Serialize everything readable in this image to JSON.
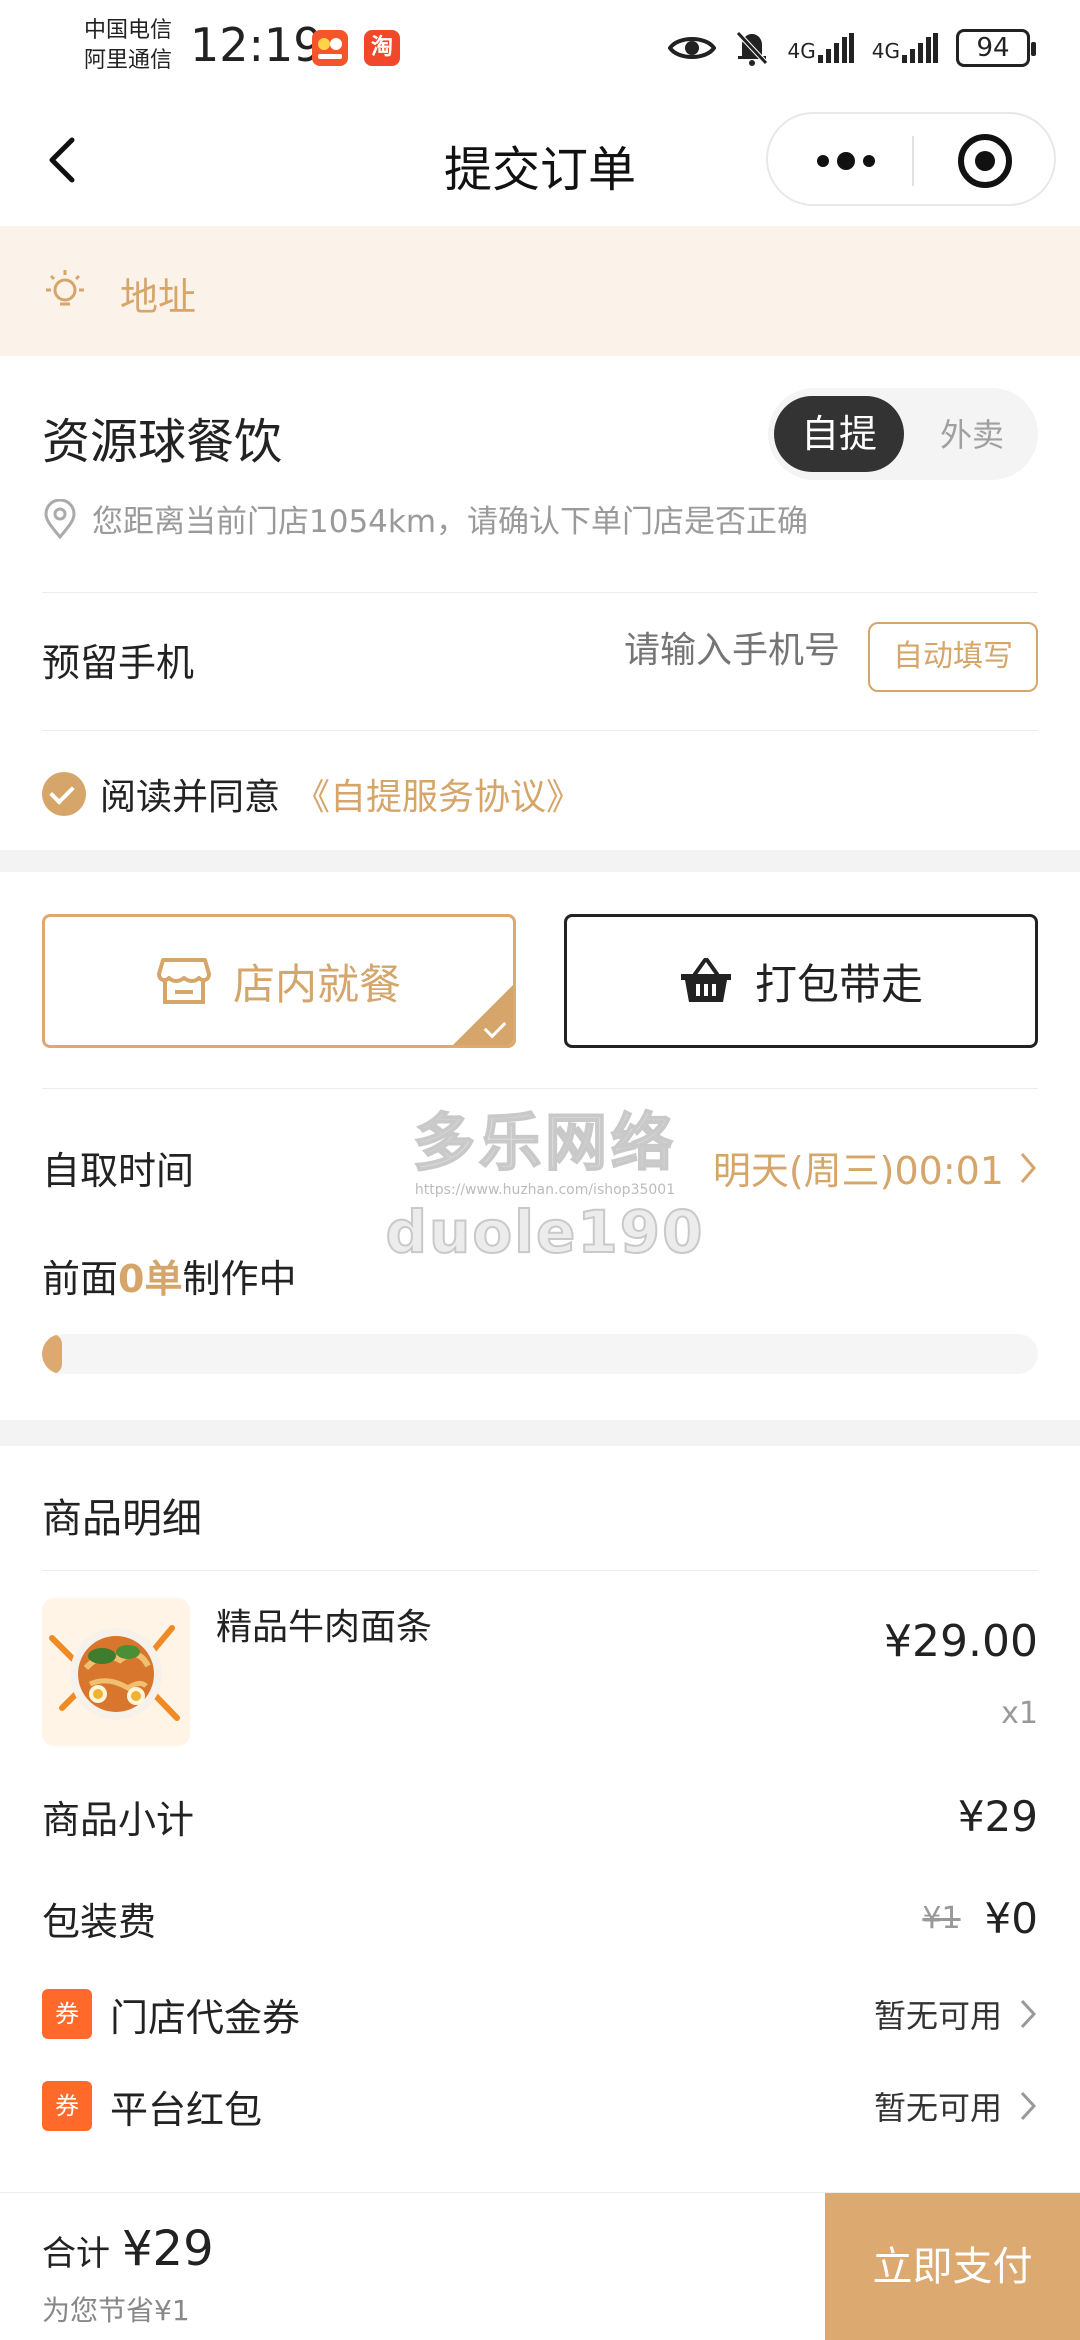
{
  "status_bar": {
    "carrier_1": "中国电信",
    "carrier_2": "阿里通信",
    "time": "12:19",
    "app_icon_1": "淘",
    "network_1": "4G",
    "network_2": "4G",
    "battery": "94"
  },
  "nav": {
    "title": "提交订单"
  },
  "address": {
    "label": "地址"
  },
  "store": {
    "name": "资源球餐饮",
    "mode_selected": "自提",
    "mode_other": "外卖",
    "distance_note": "您距离当前门店1054km，请确认下单门店是否正确"
  },
  "phone": {
    "label": "预留手机",
    "placeholder": "请输入手机号",
    "autofill_label": "自动填写"
  },
  "agreement": {
    "prefix": "阅读并同意",
    "link": "《自提服务协议》"
  },
  "dine_options": {
    "dine_in": "店内就餐",
    "takeaway": "打包带走"
  },
  "pickup": {
    "label": "自取时间",
    "value": "明天(周三)00:01"
  },
  "queue": {
    "prefix": "前面",
    "count": "0单",
    "suffix": "制作中",
    "progress": 0.02
  },
  "watermark": {
    "line1": "多乐网络",
    "line2": "https://www.huzhan.com/ishop35001",
    "line3": "duole190"
  },
  "goods": {
    "title": "商品明细",
    "items": [
      {
        "name": "精品牛肉面条",
        "price": "¥29.00",
        "qty": "x1"
      }
    ]
  },
  "fees": {
    "subtotal_label": "商品小计",
    "subtotal_value": "¥29",
    "packing_label": "包装费",
    "packing_original": "¥1",
    "packing_value": "¥0"
  },
  "discounts": [
    {
      "badge": "券",
      "label": "门店代金券",
      "status": "暂无可用"
    },
    {
      "badge": "券",
      "label": "平台红包",
      "status": "暂无可用"
    }
  ],
  "footer": {
    "total_label": "合计",
    "total_value": "¥29",
    "saved": "为您节省¥1",
    "pay_label": "立即支付"
  },
  "colors": {
    "accent": "#d6a56a",
    "banner_bg": "#fbf3ea",
    "coupon_badge": "#ff6a2b"
  }
}
